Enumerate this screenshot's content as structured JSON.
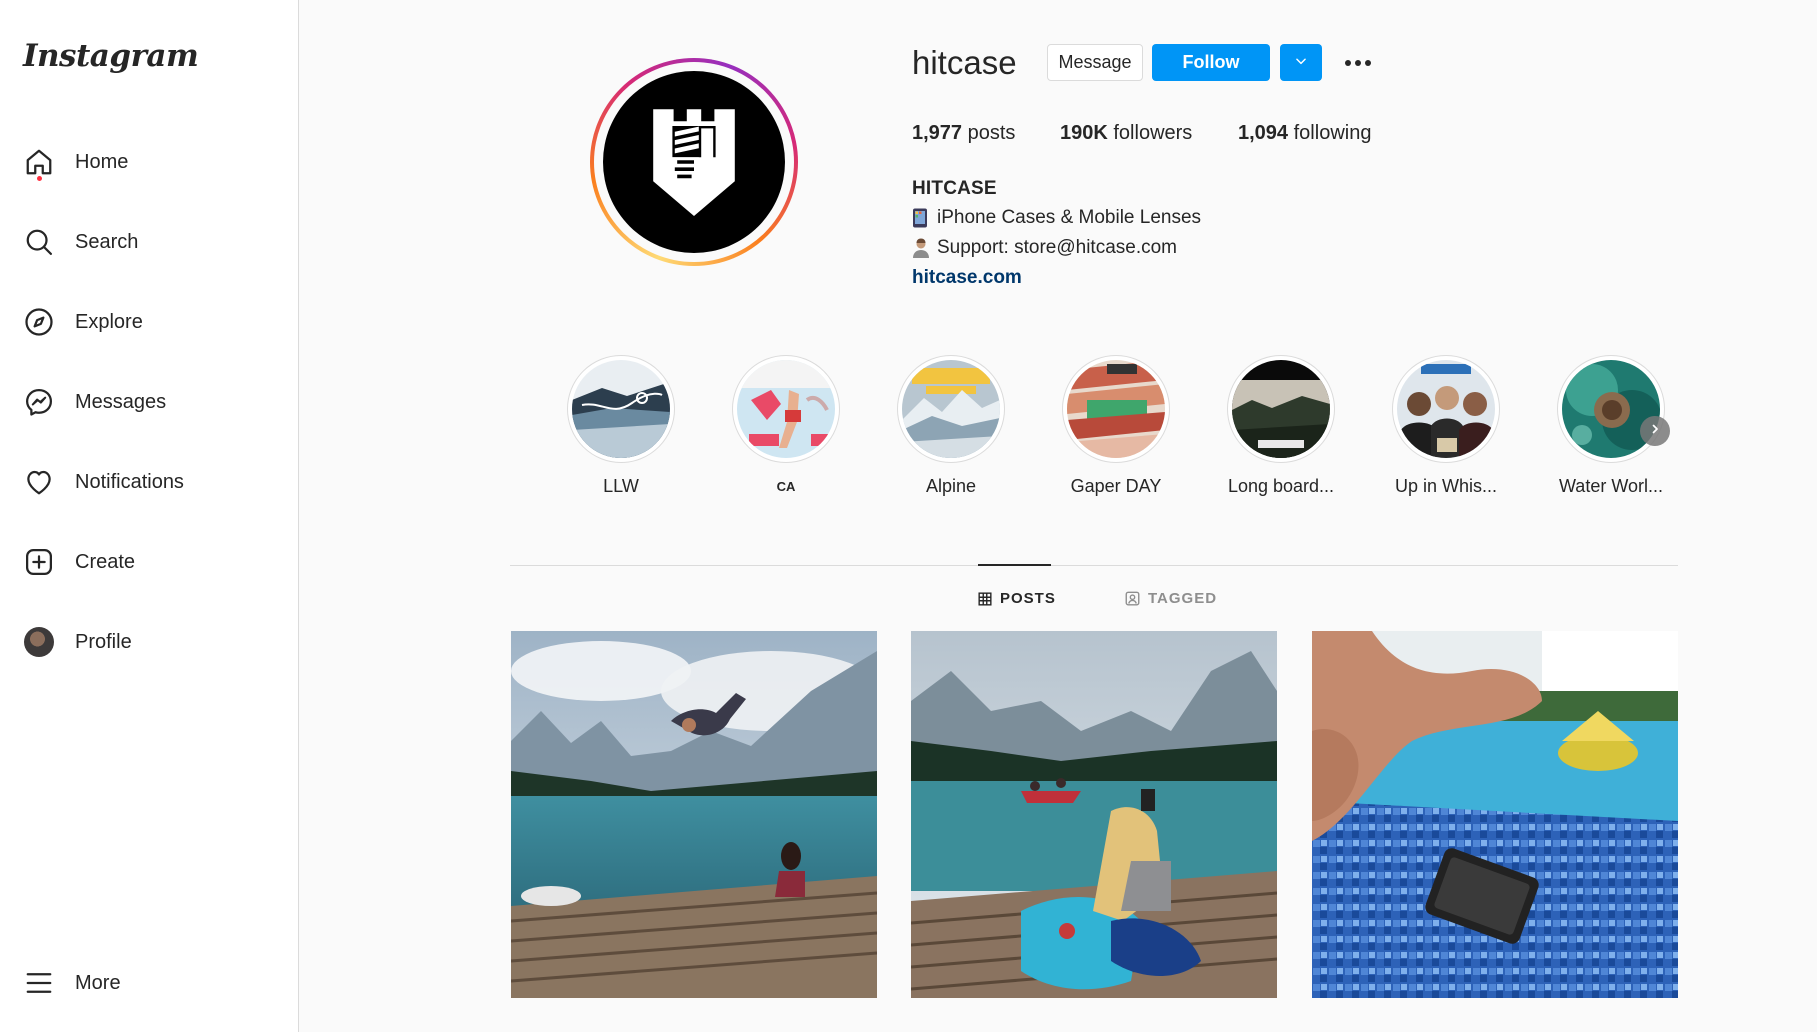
{
  "sidebar": {
    "logo": "Instagram",
    "items": [
      {
        "label": "Home",
        "icon": "home-icon"
      },
      {
        "label": "Search",
        "icon": "search-icon"
      },
      {
        "label": "Explore",
        "icon": "compass-icon"
      },
      {
        "label": "Messages",
        "icon": "messenger-icon"
      },
      {
        "label": "Notifications",
        "icon": "heart-icon"
      },
      {
        "label": "Create",
        "icon": "plus-square-icon"
      },
      {
        "label": "Profile",
        "icon": "avatar"
      }
    ],
    "more_label": "More"
  },
  "profile": {
    "username": "hitcase",
    "message_label": "Message",
    "follow_label": "Follow",
    "stats": {
      "posts_count": "1,977",
      "posts_label": "posts",
      "followers_count": "190K",
      "followers_label": "followers",
      "following_count": "1,094",
      "following_label": "following"
    },
    "bio_name": "HITCASE",
    "bio_line1": "iPhone Cases & Mobile Lenses",
    "bio_line2": "Support: store@hitcase.com",
    "link": "hitcase.com"
  },
  "highlights": [
    {
      "label": "LLW"
    },
    {
      "label": "CA"
    },
    {
      "label": "Alpine"
    },
    {
      "label": "Gaper DAY"
    },
    {
      "label": "Long board..."
    },
    {
      "label": "Up in Whis..."
    },
    {
      "label": "Water Worl..."
    }
  ],
  "tabs": {
    "posts": "POSTS",
    "tagged": "TAGGED"
  },
  "colors": {
    "accent": "#0095f6",
    "link": "#00376b",
    "notification_dot": "#ff3040"
  }
}
